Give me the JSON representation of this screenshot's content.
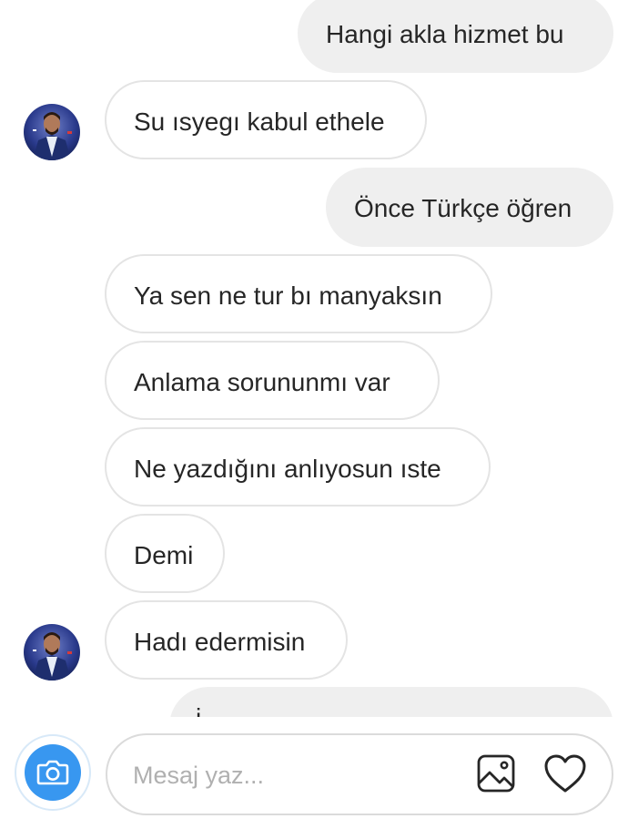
{
  "messages": [
    {
      "side": "out",
      "text": "Hangi akla hizmet bu"
    },
    {
      "side": "in",
      "text": "Su ısyegı kabul ethele"
    },
    {
      "side": "out",
      "text": "Önce Türkçe öğren"
    },
    {
      "side": "in",
      "text": "Ya sen ne tur bı manyaksın"
    },
    {
      "side": "in",
      "text": "Anlama sorununmı var"
    },
    {
      "side": "in",
      "text": "Ne yazdığını anlıyosun ıste"
    },
    {
      "side": "in",
      "text": "Demi"
    },
    {
      "side": "in",
      "text": "Hadı edermisin"
    },
    {
      "side": "out",
      "text": "i"
    }
  ],
  "composer": {
    "placeholder": "Mesaj yaz...",
    "camera_icon": "camera-icon",
    "gallery_icon": "image-gallery-icon",
    "like_icon": "heart-icon"
  },
  "colors": {
    "outgoing_bubble": "#efefef",
    "incoming_border": "#e4e4e4",
    "camera_blue": "#3897f0"
  }
}
